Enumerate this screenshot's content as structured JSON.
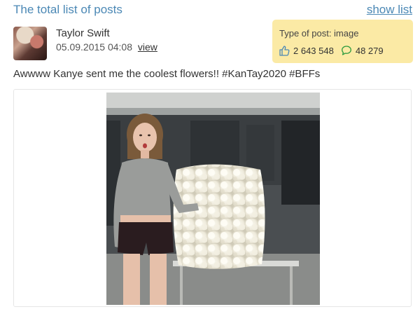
{
  "header": {
    "title": "The total list of posts",
    "show_list_label": "show list"
  },
  "post": {
    "author": "Taylor Swift",
    "date": "05.09.2015 04:08",
    "view_label": "view",
    "type_label": "Type of post: image",
    "likes": "2 643 548",
    "comments": "48 279",
    "text": "Awwww Kanye sent me the coolest flowers!! #KanTay2020 #BFFs"
  },
  "colors": {
    "link": "#4b88b5",
    "accent": "#2e9b3f",
    "type_box": "#fbeaa5"
  }
}
